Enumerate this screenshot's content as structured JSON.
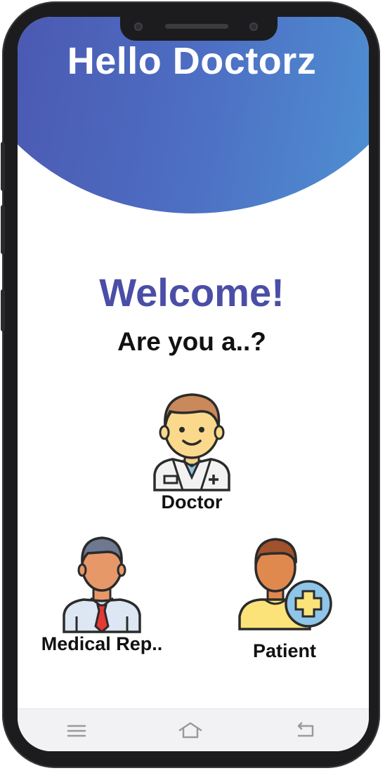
{
  "app": {
    "title": "Hello Doctorz"
  },
  "main": {
    "welcome": "Welcome!",
    "question": "Are you a..?",
    "roles": [
      {
        "label": "Doctor",
        "icon": "doctor-icon"
      },
      {
        "label": "Medical Rep..",
        "icon": "medical-rep-icon"
      },
      {
        "label": "Patient",
        "icon": "patient-icon"
      }
    ]
  },
  "navbar": {
    "icons": [
      "menu-icon",
      "home-icon",
      "back-icon"
    ]
  },
  "colors": {
    "header_gradient": [
      "#4a4ea8",
      "#4f9ad6"
    ],
    "accent": "#4b4ea6",
    "text": "#111111"
  }
}
